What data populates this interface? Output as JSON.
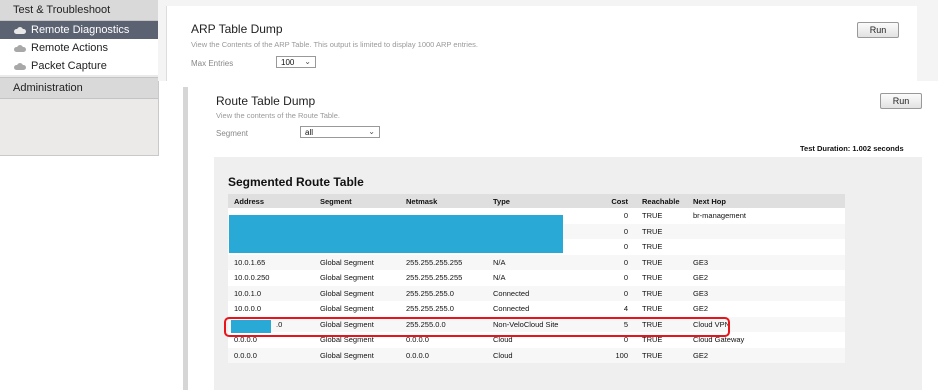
{
  "sidebar": {
    "section_test": "Test & Troubleshoot",
    "items": [
      {
        "label": "Remote Diagnostics",
        "icon": "cloud-icon",
        "active": true
      },
      {
        "label": "Remote Actions",
        "icon": "cloud-icon",
        "active": false
      },
      {
        "label": "Packet Capture",
        "icon": "cloud-icon",
        "active": false
      }
    ],
    "section_admin": "Administration"
  },
  "arp": {
    "title": "ARP Table Dump",
    "subtitle": "View the Contents of the ARP Table. This output is limited to display 1000 ARP entries.",
    "max_entries_label": "Max Entries",
    "max_entries_value": "100",
    "run_label": "Run"
  },
  "route": {
    "title": "Route Table Dump",
    "subtitle": "View the contents of the Route Table.",
    "segment_label": "Segment",
    "segment_value": "all",
    "run_label": "Run",
    "test_duration": "Test Duration: 1.002 seconds",
    "table_title": "Segmented Route Table",
    "columns": [
      "Address",
      "Segment",
      "Netmask",
      "Type",
      "Cost",
      "Reachable",
      "Next Hop"
    ],
    "rows": [
      [
        "",
        "",
        "",
        "",
        "0",
        "TRUE",
        "br-management"
      ],
      [
        "",
        "",
        "",
        "",
        "0",
        "TRUE",
        ""
      ],
      [
        "",
        "",
        "",
        "",
        "0",
        "TRUE",
        ""
      ],
      [
        "10.0.1.65",
        "Global Segment",
        "255.255.255.255",
        "N/A",
        "0",
        "TRUE",
        "GE3"
      ],
      [
        "10.0.0.250",
        "Global Segment",
        "255.255.255.255",
        "N/A",
        "0",
        "TRUE",
        "GE2"
      ],
      [
        "10.0.1.0",
        "Global Segment",
        "255.255.255.0",
        "Connected",
        "0",
        "TRUE",
        "GE3"
      ],
      [
        "10.0.0.0",
        "Global Segment",
        "255.255.255.0",
        "Connected",
        "4",
        "TRUE",
        "GE2"
      ],
      [
        ".0",
        "Global Segment",
        "255.255.0.0",
        "Non-VeloCloud Site",
        "5",
        "TRUE",
        "Cloud VPN"
      ],
      [
        "0.0.0.0",
        "Global Segment",
        "0.0.0.0",
        "Cloud",
        "0",
        "TRUE",
        "Cloud Gateway"
      ],
      [
        "0.0.0.0",
        "Global Segment",
        "0.0.0.0",
        "Cloud",
        "100",
        "TRUE",
        "GE2"
      ]
    ]
  }
}
